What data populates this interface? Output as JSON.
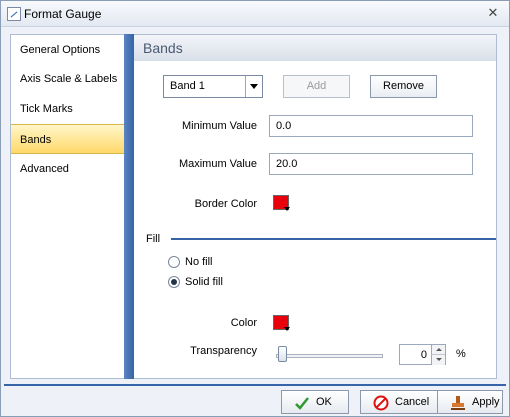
{
  "window": {
    "title": "Format Gauge",
    "close_symbol": "✕"
  },
  "nav": {
    "items": [
      {
        "label": "General Options"
      },
      {
        "label": "Axis Scale & Labels"
      },
      {
        "label": "Tick Marks"
      },
      {
        "label": "Bands",
        "active": true
      },
      {
        "label": "Advanced"
      }
    ]
  },
  "bands": {
    "header": "Bands",
    "band_select": {
      "value": "Band 1"
    },
    "add_label": "Add",
    "remove_label": "Remove",
    "min_label": "Minimum Value",
    "min_value": "0.0",
    "max_label": "Maximum Value",
    "max_value": "20.0",
    "border_color_label": "Border Color",
    "border_color": "#e8000a"
  },
  "fill": {
    "section_label": "Fill",
    "no_fill_label": "No fill",
    "solid_fill_label": "Solid fill",
    "selected": "Solid fill",
    "color_label": "Color",
    "color": "#e8000a",
    "transparency_label": "Transparency",
    "transparency_value": "0",
    "transparency_unit": "%"
  },
  "footer": {
    "ok_label": "OK",
    "cancel_label": "Cancel",
    "apply_label": "Apply"
  }
}
